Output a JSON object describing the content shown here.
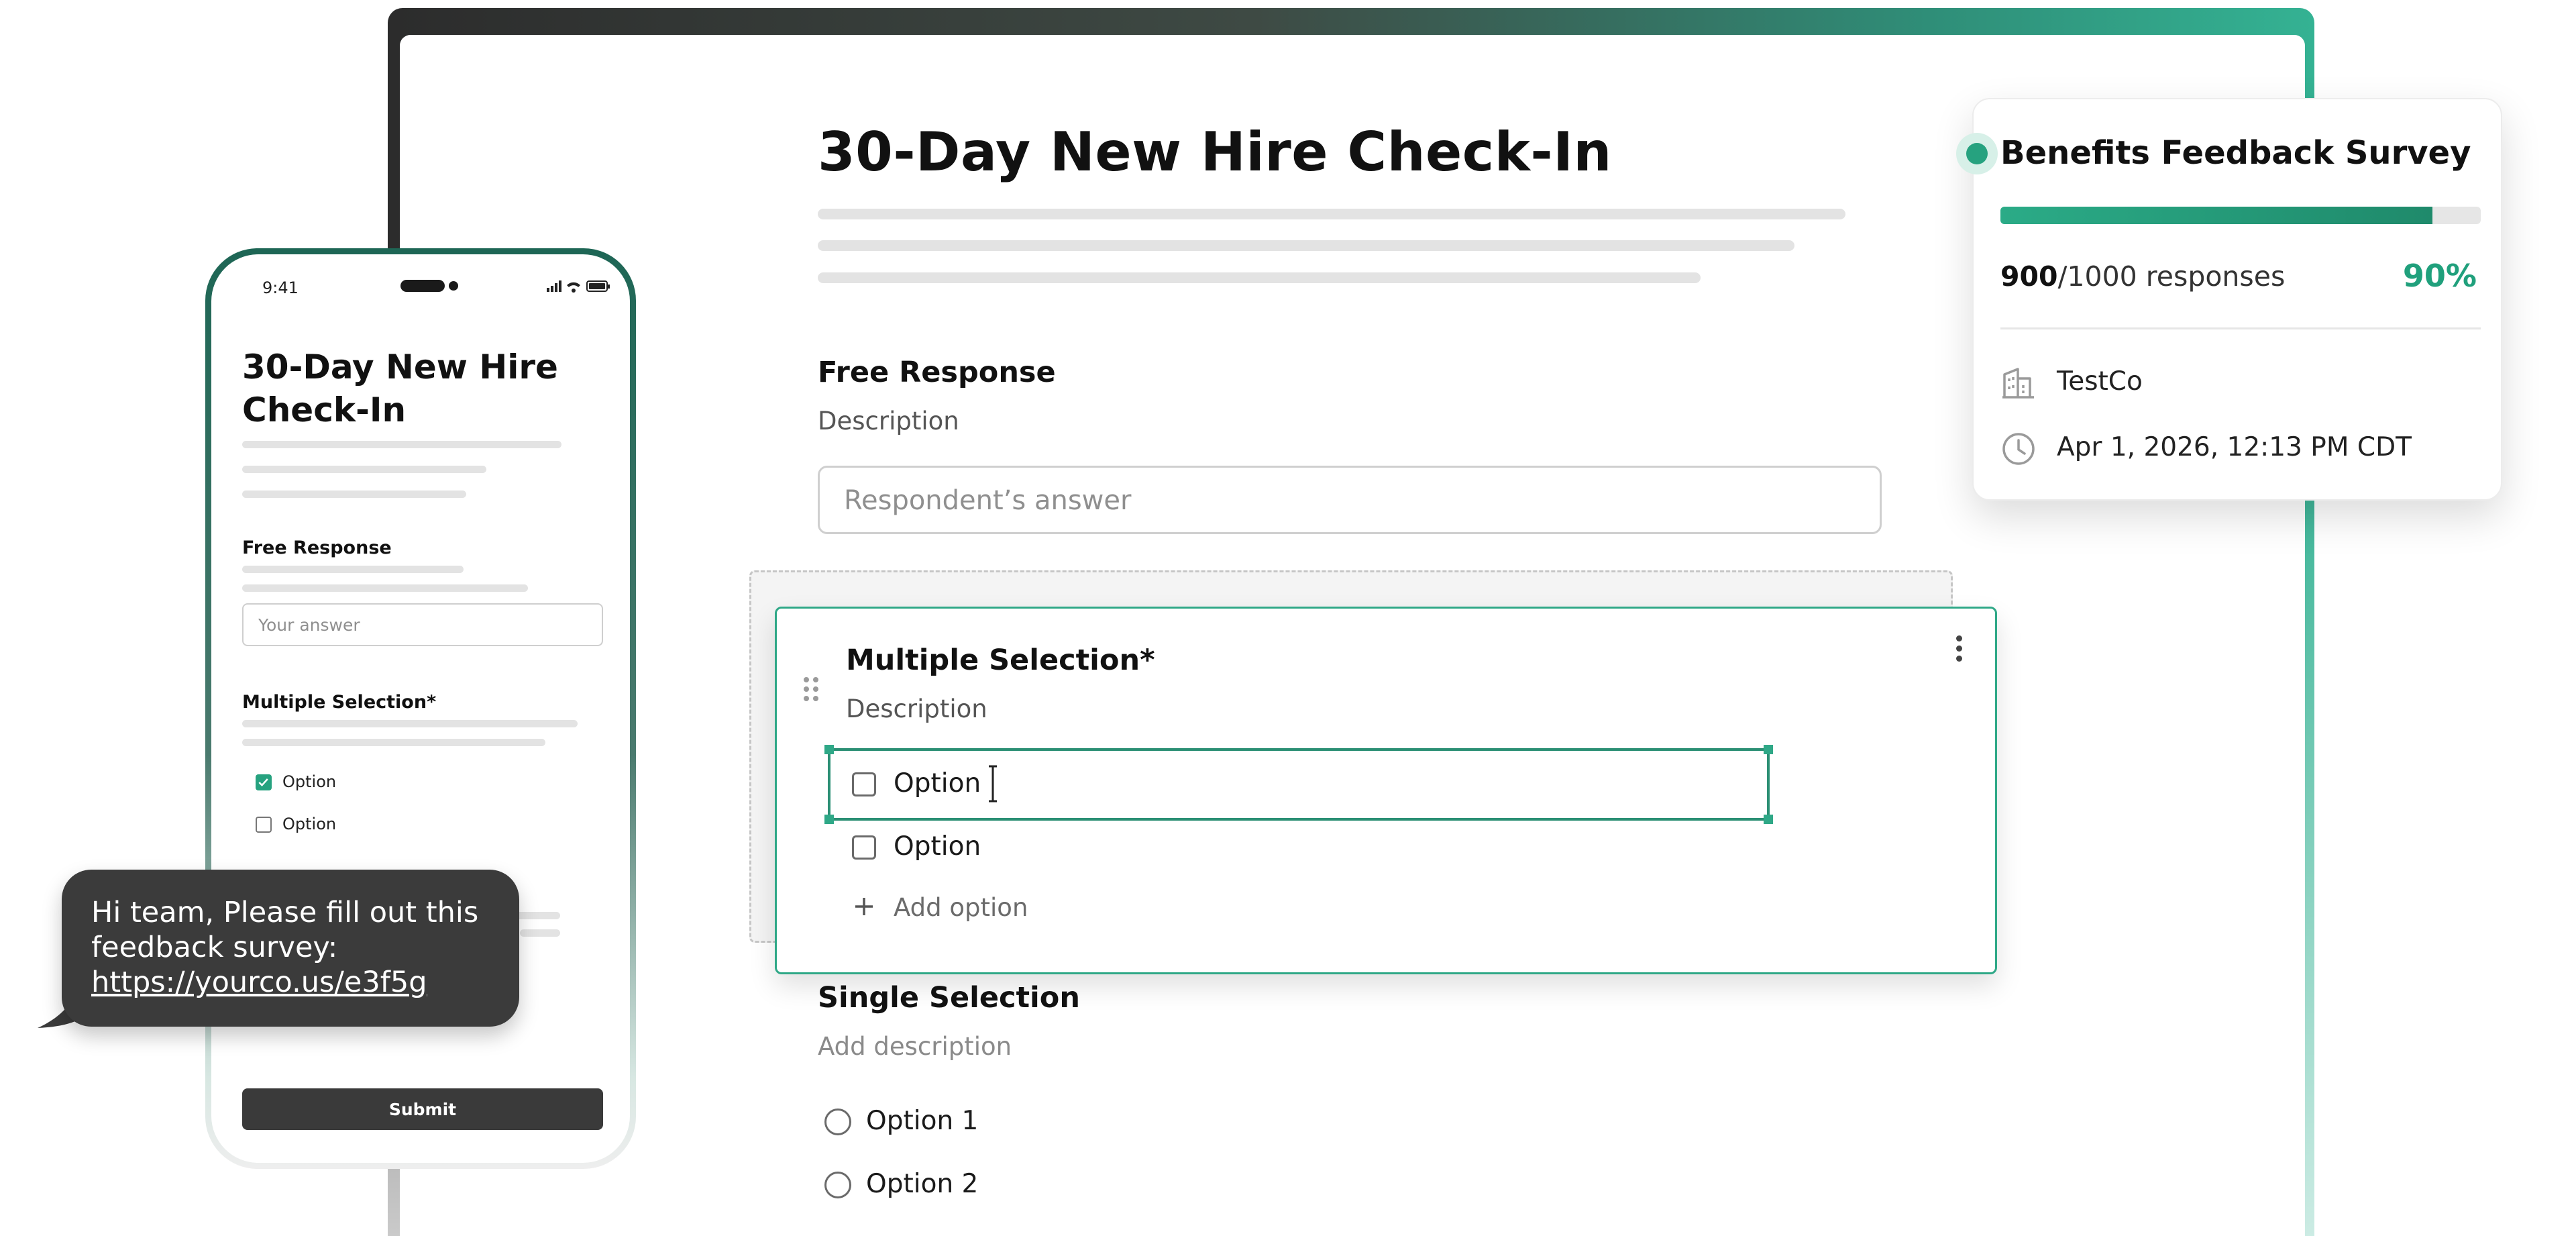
{
  "colors": {
    "accent": "#26a27f",
    "accent_dark": "#1f8a6b",
    "card_border": "#2fa887",
    "dark_button": "#3a3a3a",
    "bubble": "#3b3b3b"
  },
  "form": {
    "title": "30-Day New Hire Check-In",
    "free_response": {
      "title": "Free Response",
      "description": "Description",
      "placeholder": "Respondent’s answer"
    },
    "multiple_selection": {
      "title": "Multiple Selection*",
      "description": "Description",
      "options": [
        "Option",
        "Option"
      ],
      "add_option": "Add option"
    },
    "single_selection": {
      "title": "Single Selection",
      "description": "Add description",
      "options": [
        "Option 1",
        "Option 2"
      ]
    }
  },
  "survey_card": {
    "title": "Benefits Feedback Survey",
    "responses_count": "900",
    "responses_total": "/1000 responses",
    "progress": 0.9,
    "percent": "90%",
    "company": "TestCo",
    "datetime": "Apr 1, 2026, 12:13 PM CDT",
    "icons": [
      "building-icon",
      "clock-icon"
    ]
  },
  "phone": {
    "time": "9:41",
    "title": "30-Day New Hire Check-In",
    "free_response": {
      "title": "Free Response",
      "placeholder": "Your answer"
    },
    "multiple_selection": {
      "title": "Multiple Selection*",
      "options": [
        {
          "label": "Option",
          "checked": true
        },
        {
          "label": "Option",
          "checked": false
        }
      ]
    },
    "submit": "Submit"
  },
  "chat": {
    "message": "Hi team, Please fill out this feedback survey: ",
    "link": "https://yourco.us/e3f5g"
  }
}
